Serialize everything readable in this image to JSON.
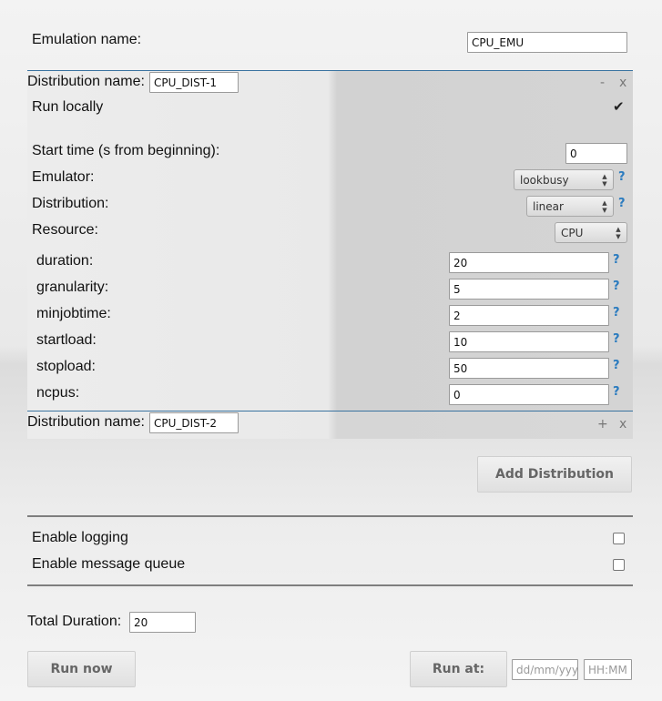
{
  "emulation": {
    "label": "Emulation name:",
    "value": "CPU_EMU"
  },
  "distribution1": {
    "name_label": "Distribution name:",
    "name_value": "CPU_DIST-1",
    "minimize": "-",
    "close": "x",
    "run_locally_label": "Run locally",
    "run_locally_checked": true,
    "start_time_label": "Start time (s from beginning):",
    "start_time_value": "0",
    "emulator_label": "Emulator:",
    "emulator_value": "lookbusy",
    "distribution_label": "Distribution:",
    "distribution_value": "linear",
    "resource_label": "Resource:",
    "resource_value": "CPU",
    "help": "?",
    "params": [
      {
        "label": "duration:",
        "value": "20"
      },
      {
        "label": "granularity:",
        "value": "5"
      },
      {
        "label": "minjobtime:",
        "value": "2"
      },
      {
        "label": "startload:",
        "value": "10"
      },
      {
        "label": "stopload:",
        "value": "50"
      },
      {
        "label": "ncpus:",
        "value": "0"
      }
    ]
  },
  "distribution2": {
    "name_label": "Distribution name:",
    "name_value": "CPU_DIST-2",
    "expand": "+",
    "close": "x"
  },
  "add_distribution_label": "Add Distribution",
  "enable_logging_label": "Enable logging",
  "enable_mq_label": "Enable message queue",
  "total_duration": {
    "label": "Total Duration:",
    "value": "20"
  },
  "run_now_label": "Run now",
  "run_at_label": "Run at:",
  "date_placeholder": "dd/mm/yyyy",
  "time_placeholder": "HH:MM"
}
